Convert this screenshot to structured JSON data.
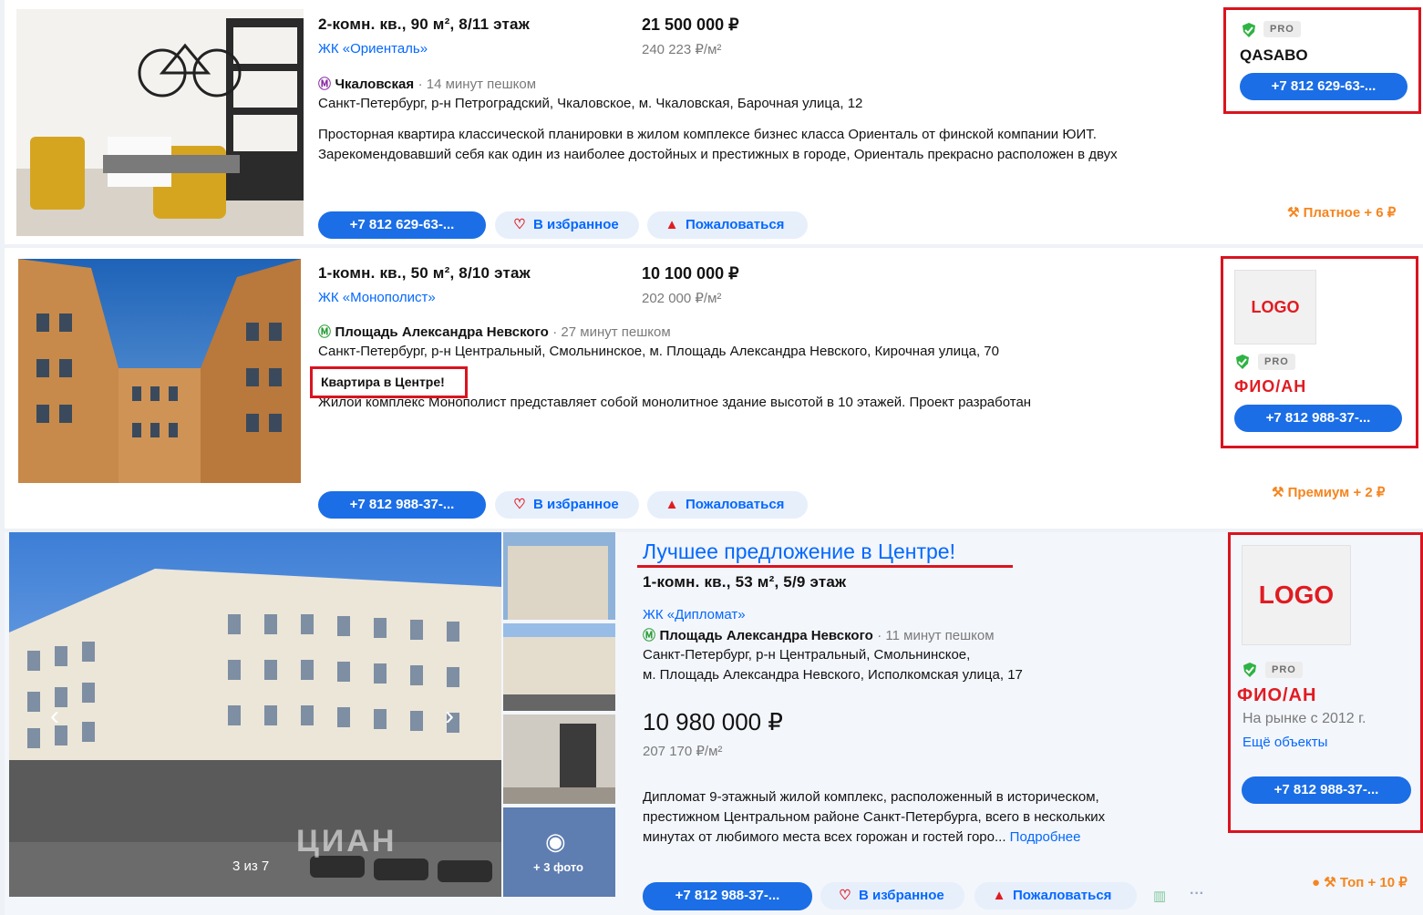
{
  "listings": [
    {
      "title": "2-комн. кв., 90 м², 8/11 этаж",
      "complex": "ЖК «Ориенталь»",
      "price": "21 500 000 ₽",
      "price_per_m": "240 223 ₽/м²",
      "metro_station": "Чкаловская",
      "metro_distance": "· 14 минут пешком",
      "address": "Санкт-Петербург, р-н Петроградский, Чкаловское, м. Чкаловская, Барочная улица, 12",
      "description_1": "Просторная квартира классической планировки в жилом комплексе бизнес класса Ориенталь от финской компании ЮИТ.",
      "description_2": "Зарекомендовавший себя как один из наиболее достойных и престижных в городе, Ориенталь прекрасно расположен в двух",
      "phone_button": "+7 812 629-63-...",
      "favorite_button": "В избранное",
      "complain_button": "Пожаловаться",
      "agent_tag": "PRO",
      "agent_name": "QASABO",
      "agent_phone": "+7 812 629-63-...",
      "paid_label": "Платное + 6 ₽",
      "metro_color": "#8b2fa4"
    },
    {
      "title": "1-комн. кв., 50 м², 8/10 этаж",
      "complex": "ЖК «Монополист»",
      "price": "10 100 000 ₽",
      "price_per_m": "202 000 ₽/м²",
      "metro_station": "Площадь Александра Невского",
      "metro_distance": "· 27 минут пешком",
      "address": "Санкт-Петербург, р-н Центральный, Смольнинское, м. Площадь Александра Невского, Кирочная улица, 70",
      "headline": "Квартира в Центре!",
      "description_1": "Жилой комплекс Монополист представляет собой монолитное здание высотой в 10 этажей. Проект разработан",
      "phone_button": "+7 812 988-37-...",
      "favorite_button": "В избранное",
      "complain_button": "Пожаловаться",
      "logo_text": "LOGO",
      "agent_tag": "PRO",
      "agent_name": "ФИО/АН",
      "agent_phone": "+7 812 988-37-...",
      "paid_label": "Премиум + 2 ₽",
      "metro_color": "#2e9e3a"
    },
    {
      "headline": "Лучшее предложение в Центре!",
      "title": "1-комн. кв., 53 м², 5/9 этаж",
      "complex": "ЖК «Дипломат»",
      "metro_station": "Площадь Александра Невского",
      "metro_distance": "· 11 минут пешком",
      "address_1": "Санкт-Петербург, р-н Центральный, Смольнинское,",
      "address_2": "м. Площадь Александра Невского, Исполкомская улица, 17",
      "price": "10 980 000 ₽",
      "price_per_m": "207 170 ₽/м²",
      "description_1": "Дипломат 9-этажный жилой комплекс, расположенный в историческом,",
      "description_2": "престижном Центральном районе Санкт-Петербурга, всего в нескольких",
      "description_3": "минутах от любимого места всех горожан и гостей горо...",
      "more_link": "Подробнее",
      "photo_counter": "3 из 7",
      "more_photos": "+ 3 фото",
      "watermark": "ЦИАН",
      "phone_button": "+7 812 988-37-...",
      "favorite_button": "В избранное",
      "complain_button": "Пожаловаться",
      "logo_text": "LOGO",
      "agent_tag": "PRO",
      "agent_name": "ФИО/АН",
      "agent_since": "На рынке с 2012 г.",
      "agent_more": "Ещё объекты",
      "agent_phone": "+7 812 988-37-...",
      "paid_label": "Топ + 10 ₽",
      "metro_color": "#2e9e3a"
    }
  ],
  "colors": {
    "accent": "#1b6ee6",
    "link": "#0468ff",
    "highlight": "#d9141f",
    "paid": "#f58520"
  }
}
